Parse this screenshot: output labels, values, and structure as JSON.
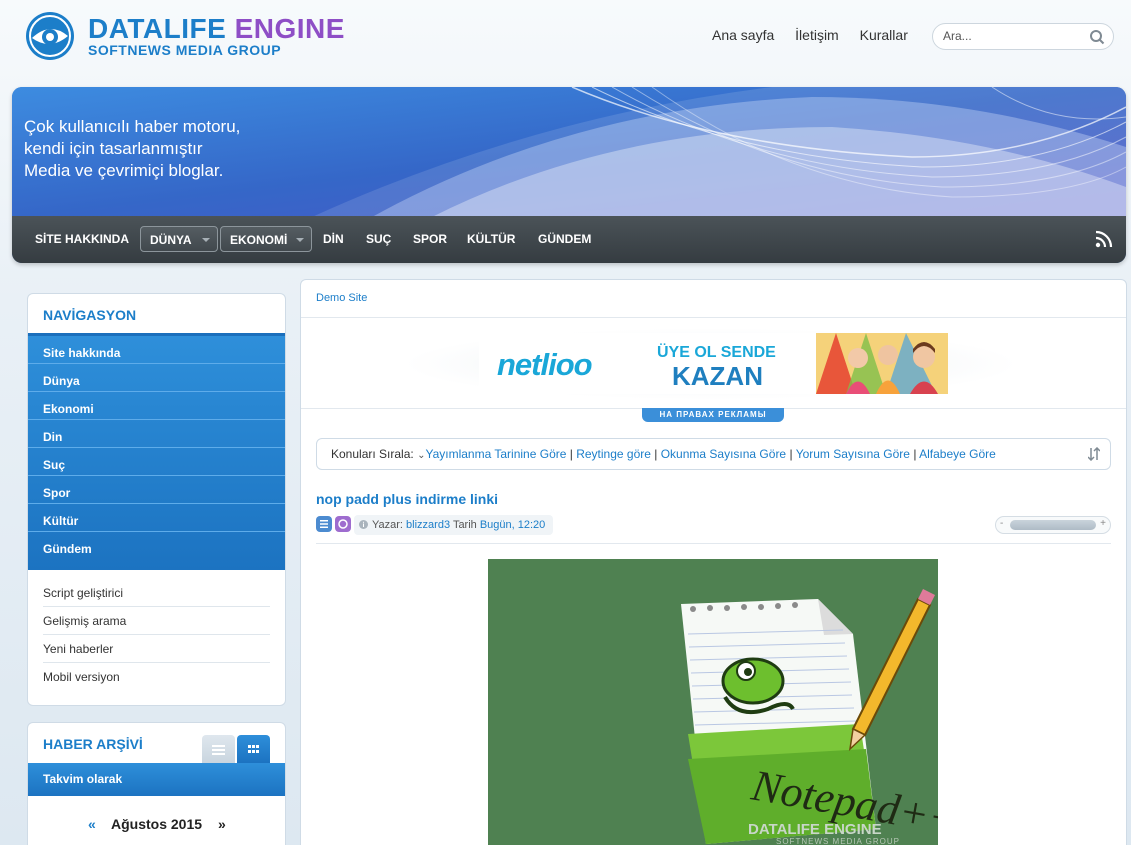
{
  "header": {
    "logo_title_1": "DATALIFE",
    "logo_title_2": "ENGINE",
    "logo_sub": "SOFTNEWS MEDIA GROUP",
    "links": [
      "Ana sayfa",
      "İletişim",
      "Kurallar"
    ],
    "search_placeholder": "Ara..."
  },
  "banner": {
    "slogan": [
      "Çok kullanıcılı haber motoru,",
      "kendi için tasarlanmıştır",
      "Media ve çevrimiçi bloglar."
    ]
  },
  "nav": {
    "items": [
      "SİTE HAKKINDA",
      "DÜNYA",
      "EKONOMİ",
      "DİN",
      "SUÇ",
      "SPOR",
      "KÜLTÜR",
      "GÜNDEM"
    ]
  },
  "sidebar": {
    "nav_title": "NAVİGASYON",
    "menu": [
      "Site hakkında",
      "Dünya",
      "Ekonomi",
      "Din",
      "Suç",
      "Spor",
      "Kültür",
      "Gündem"
    ],
    "extra": [
      "Script geliştirici",
      "Gelişmiş arama",
      "Yeni haberler",
      "Mobil versiyon"
    ],
    "archive_title": "HABER ARŞİVİ",
    "calendar_tab": "Takvim olarak",
    "calendar_prev": "«",
    "calendar_month": "Ağustos 2015",
    "calendar_next": "»"
  },
  "main": {
    "breadcrumb": "Demo Site",
    "ad": {
      "brand": "netlioo",
      "line1": "ÜYE OL SENDE",
      "line2": "KAZAN",
      "label": "НА ПРАВАХ РЕКЛАМЫ"
    },
    "sort": {
      "label": "Konuları Sırala:",
      "options": [
        "Yayımlanma Tarinine Göre",
        "Reytinge göre",
        "Okunma Sayısına Göre",
        "Yorum Sayısına Göre",
        "Alfabeye Göre"
      ]
    },
    "post": {
      "title": "nop padd plus indirme linki",
      "author_label": "Yazar:",
      "author": "blizzard3",
      "date_label": "Tarih",
      "date": "Bugün, 12:20",
      "rating_minus": "-",
      "rating_plus": "+",
      "image_watermark": "DATALIFE ENGINE",
      "image_watermark_sub": "SOFTNEWS MEDIA GROUP"
    }
  },
  "colors": {
    "accent": "#1c7ec9",
    "purple": "#8e4ec6",
    "navbar": "#3d4448"
  }
}
